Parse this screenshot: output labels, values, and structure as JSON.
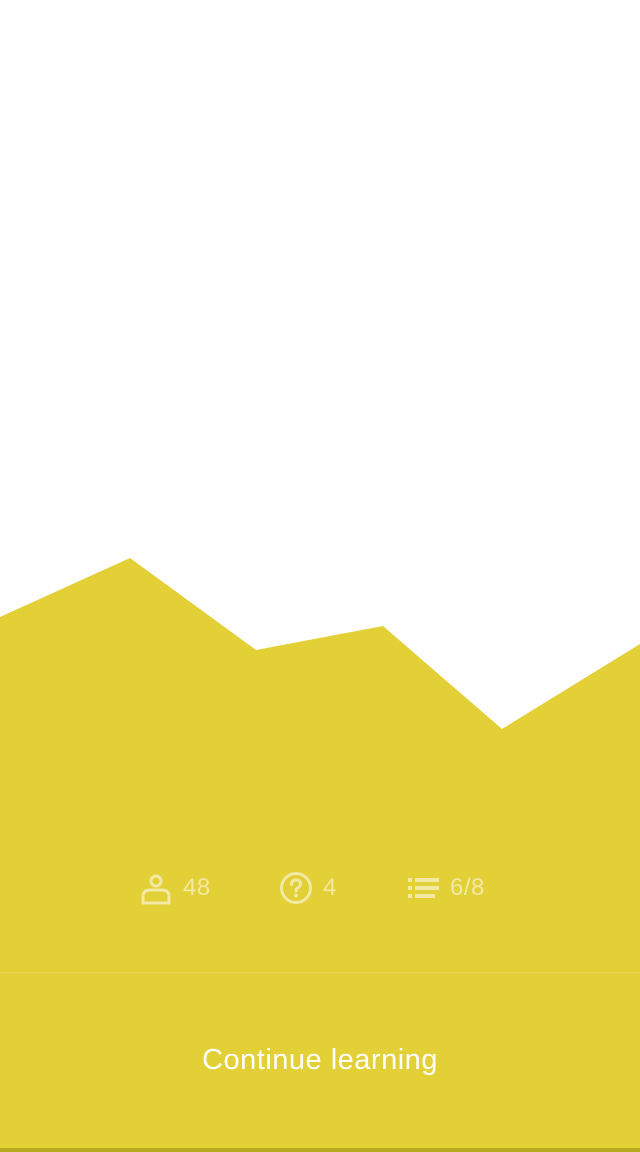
{
  "theme": {
    "accent": "#e3cf36",
    "background": "#fffeff",
    "bottom_strip": "#b9a91f"
  },
  "stats": {
    "participants": {
      "icon": "person-icon",
      "value": "48"
    },
    "questions": {
      "icon": "question-circle-icon",
      "value": "4"
    },
    "progress": {
      "icon": "list-icon",
      "value": "6/8"
    }
  },
  "continue_button": {
    "label": "Continue learning"
  }
}
